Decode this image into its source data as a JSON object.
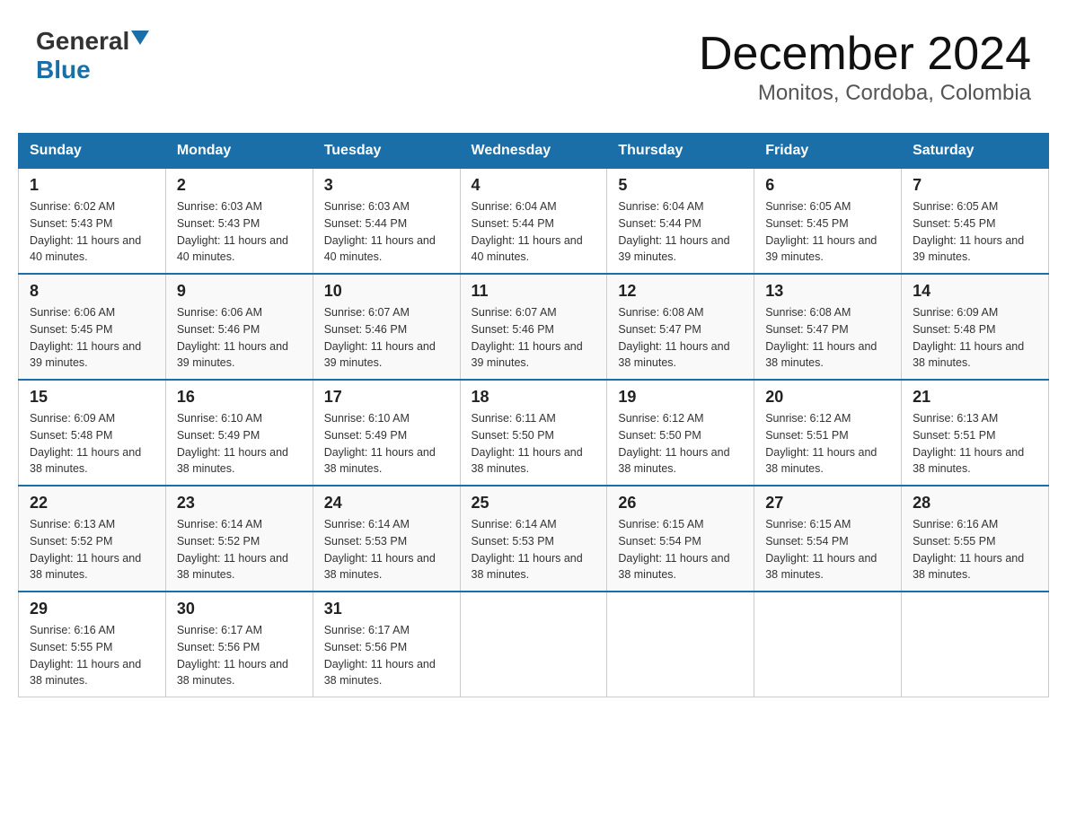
{
  "header": {
    "logo_general": "General",
    "logo_blue": "Blue",
    "title": "December 2024",
    "subtitle": "Monitos, Cordoba, Colombia"
  },
  "days_of_week": [
    "Sunday",
    "Monday",
    "Tuesday",
    "Wednesday",
    "Thursday",
    "Friday",
    "Saturday"
  ],
  "weeks": [
    {
      "days": [
        {
          "date": "1",
          "sunrise": "Sunrise: 6:02 AM",
          "sunset": "Sunset: 5:43 PM",
          "daylight": "Daylight: 11 hours and 40 minutes."
        },
        {
          "date": "2",
          "sunrise": "Sunrise: 6:03 AM",
          "sunset": "Sunset: 5:43 PM",
          "daylight": "Daylight: 11 hours and 40 minutes."
        },
        {
          "date": "3",
          "sunrise": "Sunrise: 6:03 AM",
          "sunset": "Sunset: 5:44 PM",
          "daylight": "Daylight: 11 hours and 40 minutes."
        },
        {
          "date": "4",
          "sunrise": "Sunrise: 6:04 AM",
          "sunset": "Sunset: 5:44 PM",
          "daylight": "Daylight: 11 hours and 40 minutes."
        },
        {
          "date": "5",
          "sunrise": "Sunrise: 6:04 AM",
          "sunset": "Sunset: 5:44 PM",
          "daylight": "Daylight: 11 hours and 39 minutes."
        },
        {
          "date": "6",
          "sunrise": "Sunrise: 6:05 AM",
          "sunset": "Sunset: 5:45 PM",
          "daylight": "Daylight: 11 hours and 39 minutes."
        },
        {
          "date": "7",
          "sunrise": "Sunrise: 6:05 AM",
          "sunset": "Sunset: 5:45 PM",
          "daylight": "Daylight: 11 hours and 39 minutes."
        }
      ]
    },
    {
      "days": [
        {
          "date": "8",
          "sunrise": "Sunrise: 6:06 AM",
          "sunset": "Sunset: 5:45 PM",
          "daylight": "Daylight: 11 hours and 39 minutes."
        },
        {
          "date": "9",
          "sunrise": "Sunrise: 6:06 AM",
          "sunset": "Sunset: 5:46 PM",
          "daylight": "Daylight: 11 hours and 39 minutes."
        },
        {
          "date": "10",
          "sunrise": "Sunrise: 6:07 AM",
          "sunset": "Sunset: 5:46 PM",
          "daylight": "Daylight: 11 hours and 39 minutes."
        },
        {
          "date": "11",
          "sunrise": "Sunrise: 6:07 AM",
          "sunset": "Sunset: 5:46 PM",
          "daylight": "Daylight: 11 hours and 39 minutes."
        },
        {
          "date": "12",
          "sunrise": "Sunrise: 6:08 AM",
          "sunset": "Sunset: 5:47 PM",
          "daylight": "Daylight: 11 hours and 38 minutes."
        },
        {
          "date": "13",
          "sunrise": "Sunrise: 6:08 AM",
          "sunset": "Sunset: 5:47 PM",
          "daylight": "Daylight: 11 hours and 38 minutes."
        },
        {
          "date": "14",
          "sunrise": "Sunrise: 6:09 AM",
          "sunset": "Sunset: 5:48 PM",
          "daylight": "Daylight: 11 hours and 38 minutes."
        }
      ]
    },
    {
      "days": [
        {
          "date": "15",
          "sunrise": "Sunrise: 6:09 AM",
          "sunset": "Sunset: 5:48 PM",
          "daylight": "Daylight: 11 hours and 38 minutes."
        },
        {
          "date": "16",
          "sunrise": "Sunrise: 6:10 AM",
          "sunset": "Sunset: 5:49 PM",
          "daylight": "Daylight: 11 hours and 38 minutes."
        },
        {
          "date": "17",
          "sunrise": "Sunrise: 6:10 AM",
          "sunset": "Sunset: 5:49 PM",
          "daylight": "Daylight: 11 hours and 38 minutes."
        },
        {
          "date": "18",
          "sunrise": "Sunrise: 6:11 AM",
          "sunset": "Sunset: 5:50 PM",
          "daylight": "Daylight: 11 hours and 38 minutes."
        },
        {
          "date": "19",
          "sunrise": "Sunrise: 6:12 AM",
          "sunset": "Sunset: 5:50 PM",
          "daylight": "Daylight: 11 hours and 38 minutes."
        },
        {
          "date": "20",
          "sunrise": "Sunrise: 6:12 AM",
          "sunset": "Sunset: 5:51 PM",
          "daylight": "Daylight: 11 hours and 38 minutes."
        },
        {
          "date": "21",
          "sunrise": "Sunrise: 6:13 AM",
          "sunset": "Sunset: 5:51 PM",
          "daylight": "Daylight: 11 hours and 38 minutes."
        }
      ]
    },
    {
      "days": [
        {
          "date": "22",
          "sunrise": "Sunrise: 6:13 AM",
          "sunset": "Sunset: 5:52 PM",
          "daylight": "Daylight: 11 hours and 38 minutes."
        },
        {
          "date": "23",
          "sunrise": "Sunrise: 6:14 AM",
          "sunset": "Sunset: 5:52 PM",
          "daylight": "Daylight: 11 hours and 38 minutes."
        },
        {
          "date": "24",
          "sunrise": "Sunrise: 6:14 AM",
          "sunset": "Sunset: 5:53 PM",
          "daylight": "Daylight: 11 hours and 38 minutes."
        },
        {
          "date": "25",
          "sunrise": "Sunrise: 6:14 AM",
          "sunset": "Sunset: 5:53 PM",
          "daylight": "Daylight: 11 hours and 38 minutes."
        },
        {
          "date": "26",
          "sunrise": "Sunrise: 6:15 AM",
          "sunset": "Sunset: 5:54 PM",
          "daylight": "Daylight: 11 hours and 38 minutes."
        },
        {
          "date": "27",
          "sunrise": "Sunrise: 6:15 AM",
          "sunset": "Sunset: 5:54 PM",
          "daylight": "Daylight: 11 hours and 38 minutes."
        },
        {
          "date": "28",
          "sunrise": "Sunrise: 6:16 AM",
          "sunset": "Sunset: 5:55 PM",
          "daylight": "Daylight: 11 hours and 38 minutes."
        }
      ]
    },
    {
      "days": [
        {
          "date": "29",
          "sunrise": "Sunrise: 6:16 AM",
          "sunset": "Sunset: 5:55 PM",
          "daylight": "Daylight: 11 hours and 38 minutes."
        },
        {
          "date": "30",
          "sunrise": "Sunrise: 6:17 AM",
          "sunset": "Sunset: 5:56 PM",
          "daylight": "Daylight: 11 hours and 38 minutes."
        },
        {
          "date": "31",
          "sunrise": "Sunrise: 6:17 AM",
          "sunset": "Sunset: 5:56 PM",
          "daylight": "Daylight: 11 hours and 38 minutes."
        },
        null,
        null,
        null,
        null
      ]
    }
  ]
}
